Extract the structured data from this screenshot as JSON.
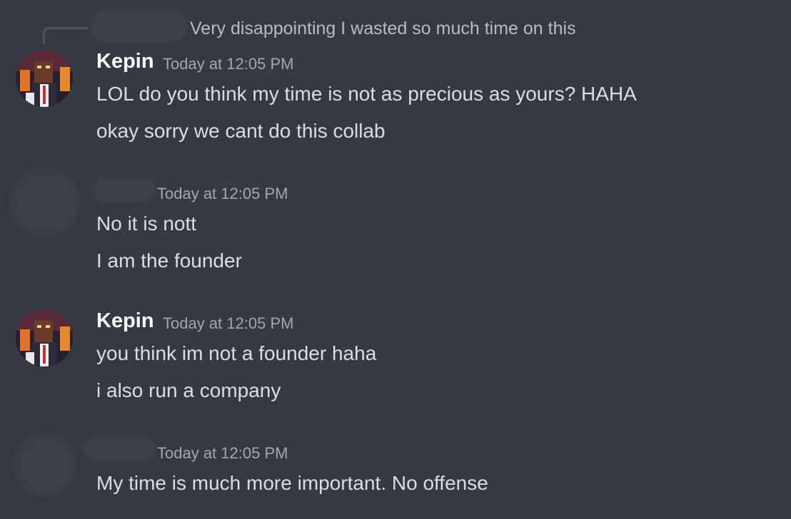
{
  "reply": {
    "text": "Very disappointing I wasted so much time on this"
  },
  "groups": [
    {
      "author": "Kepin",
      "timestamp": "Today at 12:05 PM",
      "messages": [
        "LOL do you think my time is not as precious as yours? HAHA",
        "okay sorry we cant do this collab"
      ]
    },
    {
      "author": "",
      "timestamp": "Today at 12:05 PM",
      "messages": [
        "No it is nott",
        "I am the founder"
      ]
    },
    {
      "author": "Kepin",
      "timestamp": "Today at 12:05 PM",
      "messages": [
        "you think im not a founder haha",
        "i also run a company"
      ]
    },
    {
      "author": "",
      "timestamp": "Today at 12:05 PM",
      "messages": [
        "My time is much more important. No offense"
      ]
    }
  ],
  "colors": {
    "background": "#36393f",
    "username": "#ffffff",
    "message_text": "#dcddde",
    "timestamp": "#a3a6aa"
  }
}
